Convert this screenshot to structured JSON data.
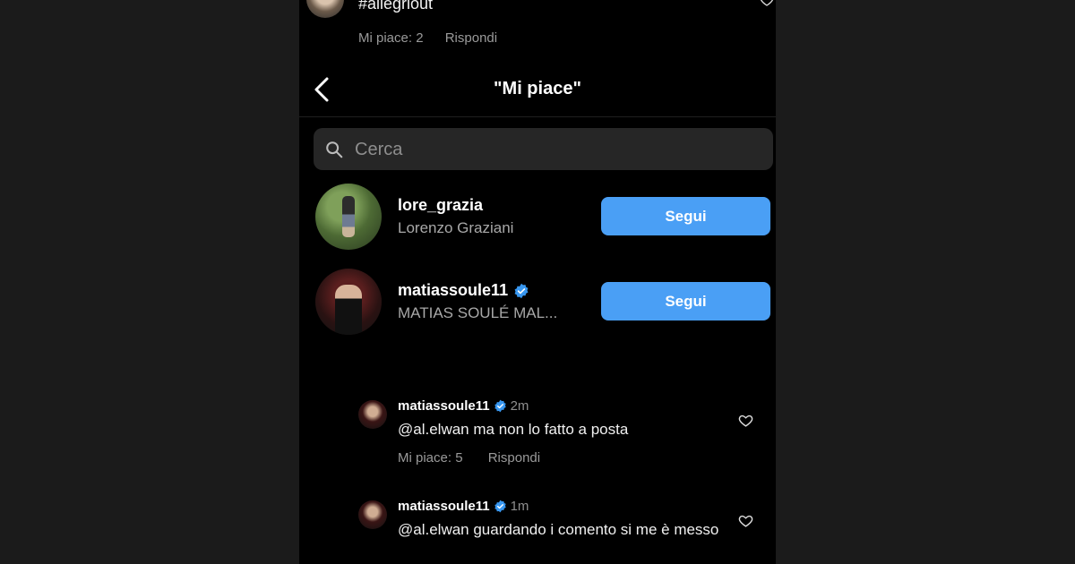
{
  "top_comment": {
    "text": "#allegriout",
    "likes": "Mi piace: 2",
    "reply": "Rispondi"
  },
  "header": {
    "title": "\"Mi piace\""
  },
  "search": {
    "placeholder": "Cerca"
  },
  "users": [
    {
      "username": "lore_grazia",
      "fullname": "Lorenzo Graziani",
      "verified": false,
      "button": "Segui"
    },
    {
      "username": "matiassoule11",
      "fullname": "MATIAS SOULÉ MAL...",
      "verified": true,
      "button": "Segui"
    }
  ],
  "comments": [
    {
      "username": "matiassoule11",
      "time": "2m",
      "text": "@al.elwan ma non lo fatto a posta",
      "likes": "Mi piace: 5",
      "reply": "Rispondi"
    },
    {
      "username": "matiassoule11",
      "time": "1m",
      "text": "@al.elwan guardando i comento si me è messo"
    }
  ],
  "colors": {
    "background": "#000000",
    "follow_button": "#4a9ff5",
    "verified_badge": "#3897f0"
  }
}
